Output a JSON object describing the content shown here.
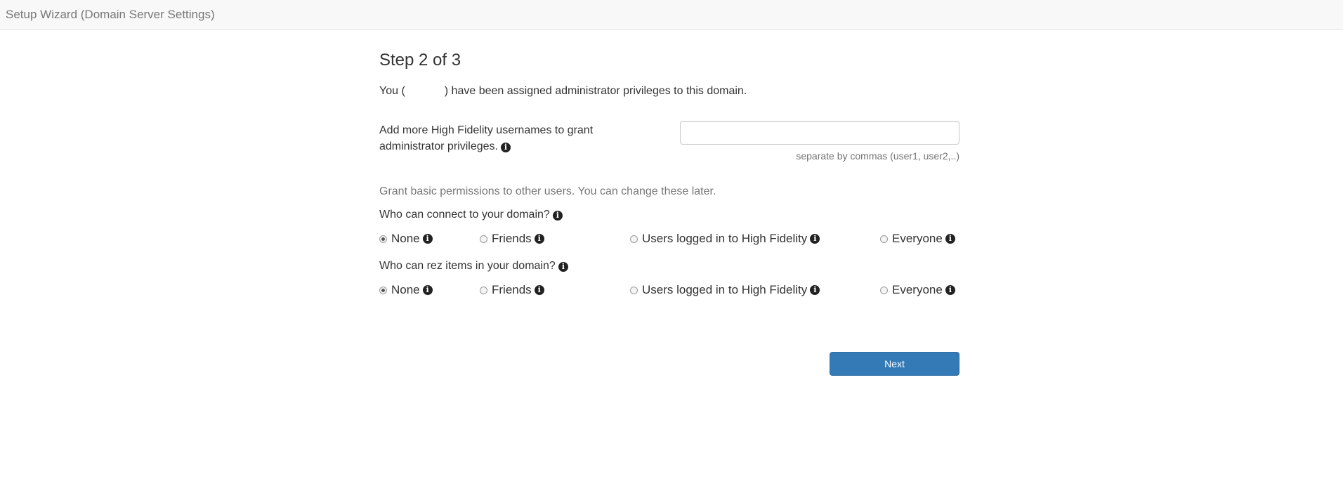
{
  "header": {
    "title": "Setup Wizard (Domain Server Settings)"
  },
  "main": {
    "heading": "Step 2 of 3",
    "admin_prefix": "You (",
    "admin_suffix": ") have been assigned administrator privileges to this domain.",
    "admins_label": "Add more High Fidelity usernames to grant administrator privileges.",
    "admins_input": {
      "value": "",
      "placeholder": ""
    },
    "admins_help": "separate by commas (user1, user2,..)",
    "grant_intro": "Grant basic permissions to other users. You can change these later.",
    "connect": {
      "question": "Who can connect to your domain?",
      "options": [
        {
          "label": "None",
          "checked": true
        },
        {
          "label": "Friends",
          "checked": false
        },
        {
          "label": "Users logged in to High Fidelity",
          "checked": false
        },
        {
          "label": "Everyone",
          "checked": false
        }
      ]
    },
    "rez": {
      "question": "Who can rez items in your domain?",
      "options": [
        {
          "label": "None",
          "checked": true
        },
        {
          "label": "Friends",
          "checked": false
        },
        {
          "label": "Users logged in to High Fidelity",
          "checked": false
        },
        {
          "label": "Everyone",
          "checked": false
        }
      ]
    },
    "next_label": "Next"
  },
  "icons": {
    "info": "info-circle-icon",
    "info_glyph": "i"
  },
  "colors": {
    "primary": "#337ab7",
    "muted": "#777777",
    "navbar": "#f8f8f8"
  }
}
